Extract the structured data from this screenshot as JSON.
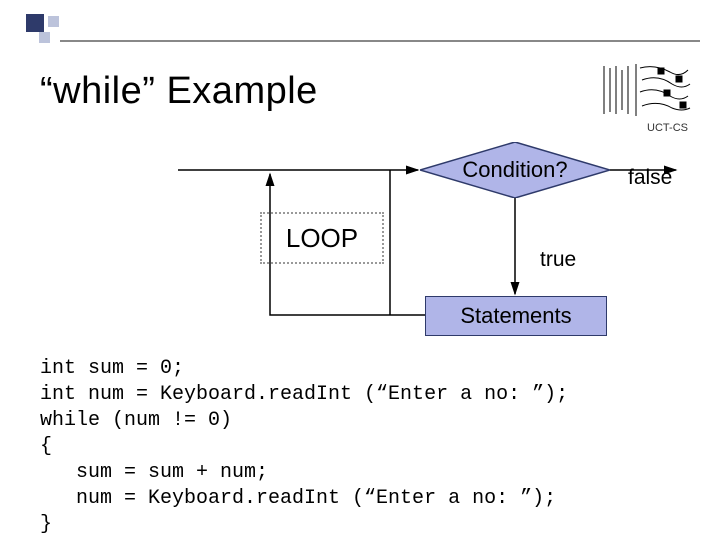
{
  "header": {
    "title": "“while” Example",
    "org": "UCT-CS"
  },
  "diagram": {
    "condition": "Condition?",
    "loop": "LOOP",
    "statements": "Statements",
    "true_label": "true",
    "false_label": "false"
  },
  "code": {
    "l1": "int sum = 0;",
    "l2": "int num = Keyboard.readInt (“Enter a no: ”);",
    "l3": "while (num != 0)",
    "l4": "{",
    "l5": "   sum = sum + num;",
    "l6": "   num = Keyboard.readInt (“Enter a no: ”);",
    "l7": "}"
  }
}
